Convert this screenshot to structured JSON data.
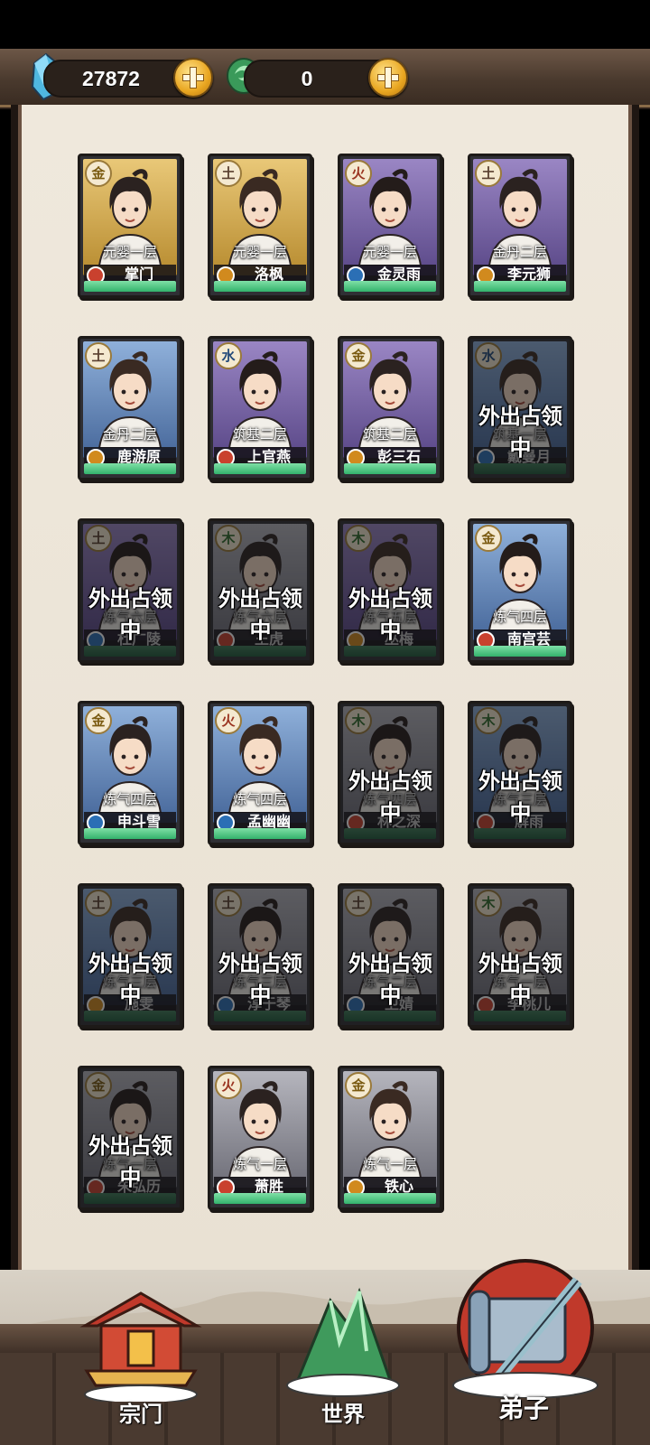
{
  "resources": {
    "spirit_stones": "27872",
    "jade": "0"
  },
  "element_glyphs": {
    "gold": "金",
    "earth": "土",
    "fire": "火",
    "water": "水",
    "wood": "木"
  },
  "away_label": "外出占领中",
  "disciples": [
    {
      "name": "掌门",
      "realm": "元婴一层",
      "element": "gold",
      "role": "red",
      "frame": "gold",
      "away": false
    },
    {
      "name": "洛枫",
      "realm": "元婴一层",
      "element": "earth",
      "role": "gold",
      "frame": "gold",
      "away": false
    },
    {
      "name": "金灵雨",
      "realm": "元婴一层",
      "element": "fire",
      "role": "blue",
      "frame": "purple",
      "away": false
    },
    {
      "name": "李元狮",
      "realm": "金丹二层",
      "element": "earth",
      "role": "gold",
      "frame": "purple",
      "away": false
    },
    {
      "name": "鹿游原",
      "realm": "金丹二层",
      "element": "earth",
      "role": "gold",
      "frame": "blue",
      "away": false
    },
    {
      "name": "上官燕",
      "realm": "筑基二层",
      "element": "water",
      "role": "red",
      "frame": "purple",
      "away": false
    },
    {
      "name": "彭三石",
      "realm": "筑基二层",
      "element": "gold",
      "role": "gold",
      "frame": "purple",
      "away": false
    },
    {
      "name": "戴曼月",
      "realm": "筑基一层",
      "element": "water",
      "role": "blue",
      "frame": "blue",
      "away": true
    },
    {
      "name": "杜广陵",
      "realm": "炼气六层",
      "element": "earth",
      "role": "blue",
      "frame": "purple",
      "away": true
    },
    {
      "name": "王虎",
      "realm": "炼气六层",
      "element": "wood",
      "role": "red",
      "frame": "grey",
      "away": true
    },
    {
      "name": "巫梅",
      "realm": "炼气五层",
      "element": "wood",
      "role": "gold",
      "frame": "purple",
      "away": true
    },
    {
      "name": "南宫芸",
      "realm": "炼气四层",
      "element": "gold",
      "role": "red",
      "frame": "blue",
      "away": false
    },
    {
      "name": "申斗雪",
      "realm": "炼气四层",
      "element": "gold",
      "role": "blue",
      "frame": "blue",
      "away": false
    },
    {
      "name": "孟幽幽",
      "realm": "炼气四层",
      "element": "fire",
      "role": "blue",
      "frame": "blue",
      "away": false
    },
    {
      "name": "林之深",
      "realm": "炼气四层",
      "element": "wood",
      "role": "red",
      "frame": "grey",
      "away": true
    },
    {
      "name": "解雨",
      "realm": "炼气三层",
      "element": "wood",
      "role": "red",
      "frame": "blue",
      "away": true
    },
    {
      "name": "施雯",
      "realm": "炼气三层",
      "element": "earth",
      "role": "gold",
      "frame": "blue",
      "away": true
    },
    {
      "name": "淳于琴",
      "realm": "炼气三层",
      "element": "earth",
      "role": "blue",
      "frame": "grey",
      "away": true
    },
    {
      "name": "卫婧",
      "realm": "炼气二层",
      "element": "earth",
      "role": "blue",
      "frame": "grey",
      "away": true
    },
    {
      "name": "李桃儿",
      "realm": "炼气一层",
      "element": "wood",
      "role": "red",
      "frame": "grey",
      "away": true
    },
    {
      "name": "朱弘历",
      "realm": "炼气一层",
      "element": "gold",
      "role": "red",
      "frame": "grey",
      "away": true
    },
    {
      "name": "萧胜",
      "realm": "炼气一层",
      "element": "fire",
      "role": "red",
      "frame": "grey",
      "away": false
    },
    {
      "name": "铁心",
      "realm": "炼气一层",
      "element": "gold",
      "role": "gold",
      "frame": "grey",
      "away": false
    }
  ],
  "nav": {
    "sect": "宗门",
    "world": "世界",
    "disciples": "弟子"
  },
  "colors": {
    "gold_frame": "#d9b25a",
    "purple_frame": "#7a66a8",
    "blue_frame": "#5c7fb3",
    "grey_frame": "#8f8f98",
    "green_bar": "#3fbf76"
  }
}
